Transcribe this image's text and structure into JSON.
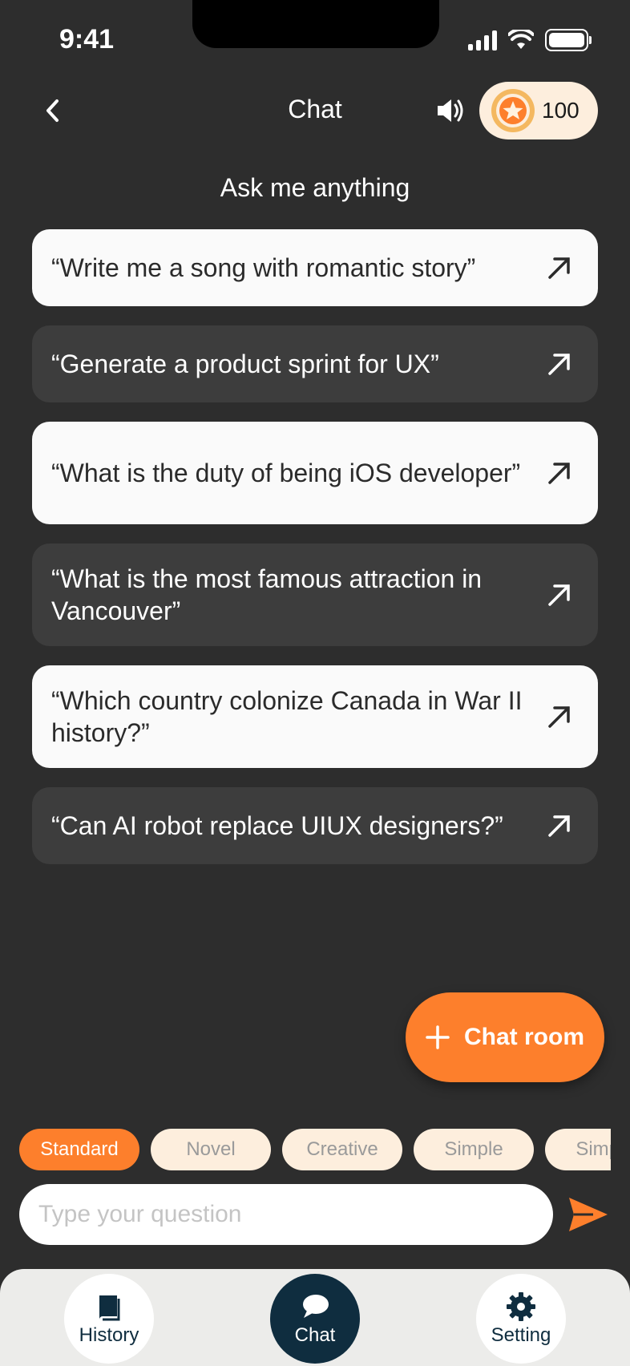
{
  "status_bar": {
    "time": "9:41"
  },
  "header": {
    "title": "Chat",
    "coins": "100"
  },
  "subtitle": "Ask me anything",
  "prompts": [
    {
      "text": "“Write me a song with romantic story”"
    },
    {
      "text": "“Generate a product sprint for UX”"
    },
    {
      "text": "“What is the duty of being iOS developer”"
    },
    {
      "text": "“What is the most famous attraction in Vancouver”"
    },
    {
      "text": "“Which country colonize Canada in War II history?”"
    },
    {
      "text": "“Can AI robot replace UIUX designers?”"
    }
  ],
  "fab": {
    "label": "Chat room"
  },
  "modes": [
    "Standard",
    "Novel",
    "Creative",
    "Simple",
    "Simple"
  ],
  "selected_mode": "Standard",
  "input": {
    "placeholder": "Type your question",
    "value": ""
  },
  "nav": {
    "history": "History",
    "chat": "Chat",
    "setting": "Setting",
    "active": "Chat"
  },
  "colors": {
    "background": "#2d2d2d",
    "accent": "#fd7f2c",
    "chip_bg": "#fdeedd",
    "nav_active": "#0f2d3f",
    "card_light": "#fafafa",
    "card_dark": "#3d3d3d"
  },
  "icons": {
    "back": "chevron-left-icon",
    "sound": "speaker-icon",
    "coin": "star-coin-icon",
    "prompt_arrow": "arrow-up-right-icon",
    "fab": "plus-icon",
    "send": "send-icon",
    "history": "book-icon",
    "chat": "chat-bubble-icon",
    "setting": "gear-icon"
  }
}
